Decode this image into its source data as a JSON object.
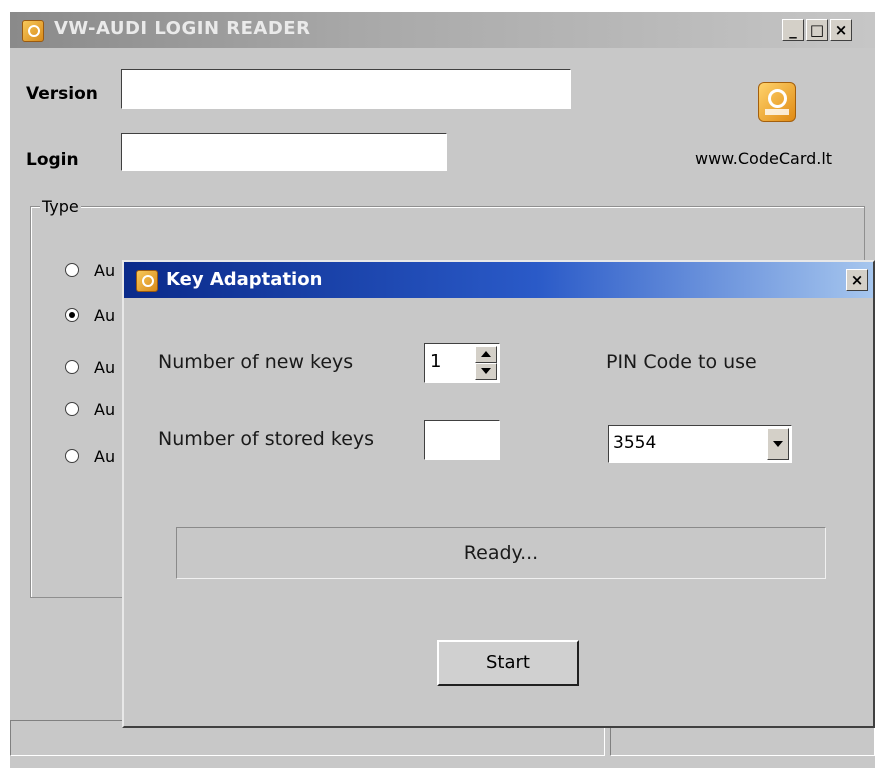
{
  "main_window": {
    "title": "VW-AUDI LOGIN READER",
    "controls": {
      "minimize": "_",
      "maximize": "□",
      "close": "×"
    },
    "version_label": "Version",
    "version_value": "",
    "login_label": "Login",
    "login_value": "",
    "site_link": "www.CodeCard.lt",
    "type_group_label": "Type",
    "type_options": [
      {
        "label": "Au",
        "checked": false
      },
      {
        "label": "Au",
        "checked": true
      },
      {
        "label": "Au",
        "checked": false
      },
      {
        "label": "Au",
        "checked": false
      },
      {
        "label": "Au",
        "checked": false
      }
    ],
    "icons": {
      "app": "app-key-icon",
      "brand": "key-card-icon"
    },
    "colors": {
      "window_bg": "#c8c8c8",
      "titlebar_inactive": "#a0a0a0"
    }
  },
  "dialog": {
    "title": "Key Adaptation",
    "close": "×",
    "new_keys_label": "Number of new keys",
    "new_keys_value": "1",
    "stored_keys_label": "Number of stored keys",
    "stored_keys_value": "",
    "pin_label": "PIN Code to use",
    "pin_value": "3554",
    "status": "Ready...",
    "start_label": "Start",
    "colors": {
      "titlebar_start": "#0a2a8a",
      "titlebar_end": "#a6c6ee"
    }
  }
}
